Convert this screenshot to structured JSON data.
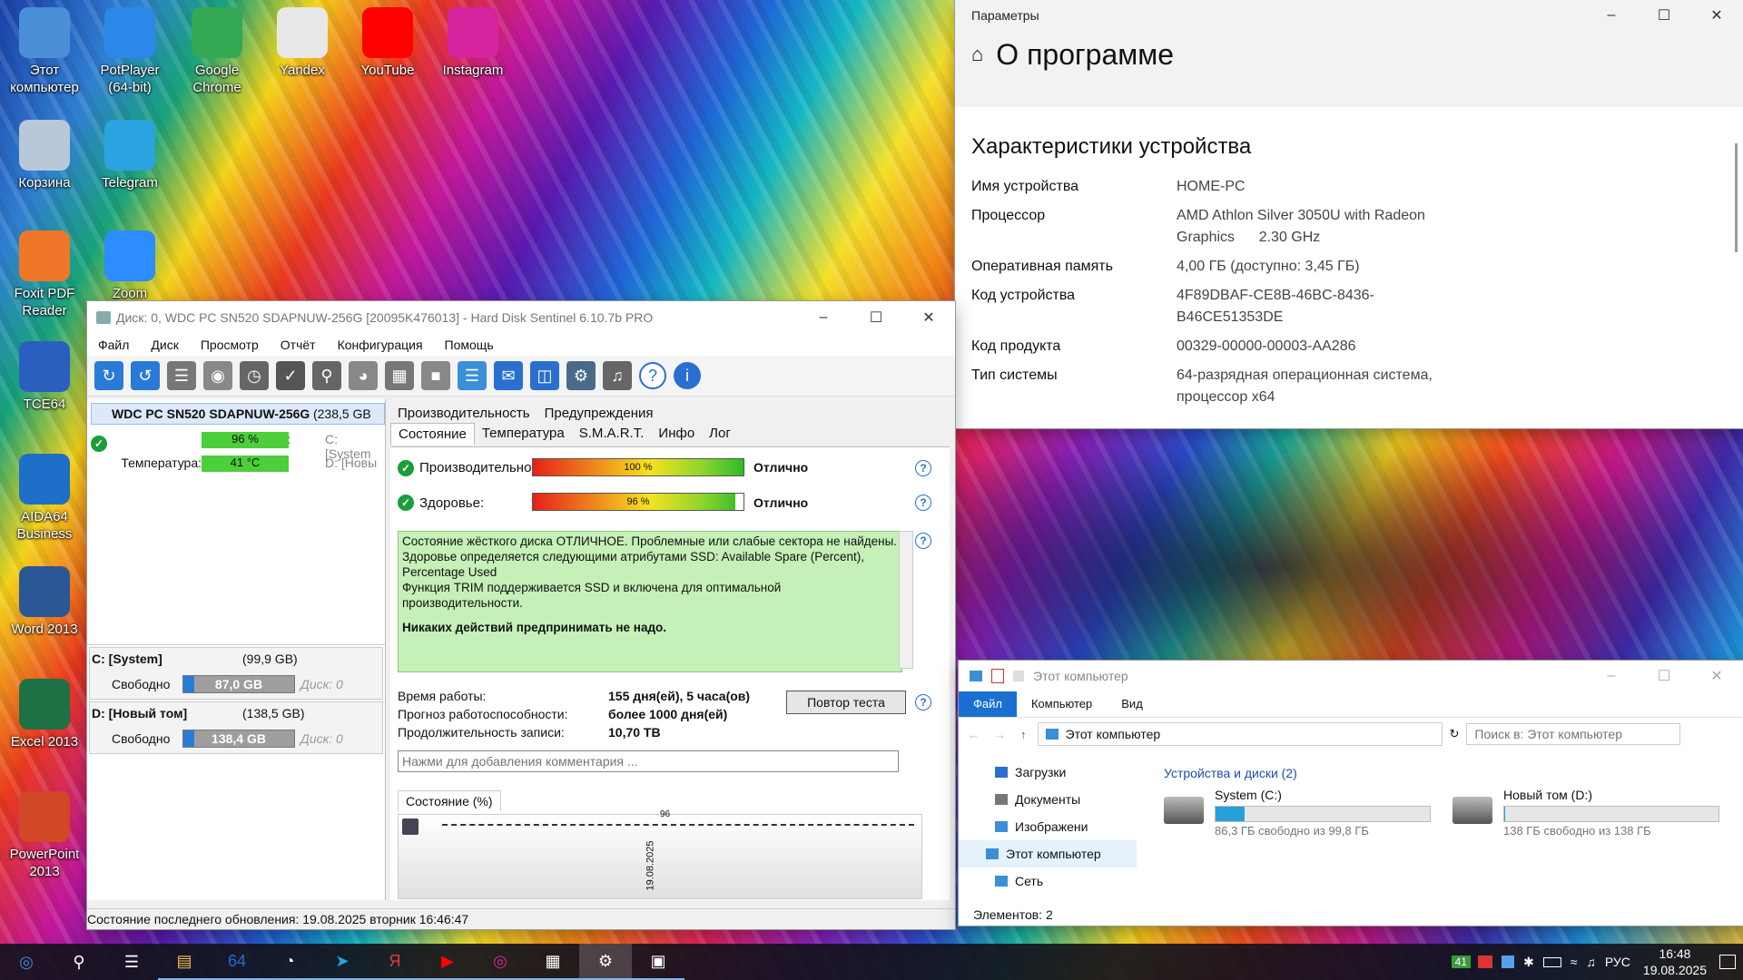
{
  "desktop": {
    "icons": [
      {
        "label": "Этот компьютер",
        "icon": "computer-icon",
        "color": "#4a8fd8"
      },
      {
        "label": "PotPlayer (64-bit)",
        "icon": "potplayer-icon",
        "color": "#2b88e8"
      },
      {
        "label": "Google Chrome",
        "icon": "chrome-icon",
        "color": "#34a853"
      },
      {
        "label": "Yandex",
        "icon": "yandex-icon",
        "color": "#e8e8e8"
      },
      {
        "label": "YouTube",
        "icon": "youtube-icon",
        "color": "#ff0000"
      },
      {
        "label": "Instagram",
        "icon": "instagram-icon",
        "color": "#d6249f"
      },
      {
        "label": "Корзина",
        "icon": "recycle-bin-icon",
        "color": "#b8c8d8"
      },
      {
        "label": "Telegram",
        "icon": "telegram-icon",
        "color": "#2aa3e0"
      },
      {
        "label": "Foxit PDF Reader",
        "icon": "foxit-icon",
        "color": "#f0772a"
      },
      {
        "label": "Zoom",
        "icon": "zoom-icon",
        "color": "#2d8cff"
      },
      {
        "label": "TCE64",
        "icon": "tce64-icon",
        "color": "#2a5fc0"
      },
      {
        "label": "AIDA64 Business",
        "icon": "aida64-icon",
        "color": "#1e6fc8"
      },
      {
        "label": "Word 2013",
        "icon": "word-icon",
        "color": "#2b5797"
      },
      {
        "label": "Excel 2013",
        "icon": "excel-icon",
        "color": "#1e7145"
      },
      {
        "label": "PowerPoint 2013",
        "icon": "powerpoint-icon",
        "color": "#d24726"
      }
    ]
  },
  "settings": {
    "title": "Параметры",
    "heading": "О программе",
    "section": "Характеристики устройства",
    "rows": [
      {
        "label": "Имя устройства",
        "value": "HOME-PC"
      },
      {
        "label": "Процессор",
        "value": "AMD Athlon Silver 3050U with Radeon Graphics      2.30 GHz"
      },
      {
        "label": "Оперативная память",
        "value": "4,00 ГБ (доступно: 3,45 ГБ)"
      },
      {
        "label": "Код устройства",
        "value": "4F89DBAF-CE8B-46BC-8436-B46CE51353DE"
      },
      {
        "label": "Код продукта",
        "value": "00329-00000-00003-AA286"
      },
      {
        "label": "Тип системы",
        "value": "64-разрядная операционная система, процессор x64"
      }
    ]
  },
  "hds": {
    "title": "Диск: 0, WDC PC SN520 SDAPNUW-256G [20095K476013]  -  Hard Disk Sentinel 6.10.7b PRO",
    "menu": [
      "Файл",
      "Диск",
      "Просмотр",
      "Отчёт",
      "Конфигурация",
      "Помощь"
    ],
    "disk_name": "WDC PC SN520 SDAPNUW-256G",
    "disk_size": "(238,5 GB",
    "health_label": "Здоровье:",
    "health_value": "96 %",
    "health_pct": 96,
    "health_side": "C: [System",
    "temp_label": "Температура:",
    "temp_value": "41 °C",
    "temp_side": "D: [Новы",
    "volumes": [
      {
        "name": "C: [System]",
        "size": "(99,9 GB)",
        "free_label": "Свободно",
        "free": "87,0 GB",
        "disk": "Диск: 0"
      },
      {
        "name": "D: [Новый том]",
        "size": "(138,5 GB)",
        "free_label": "Свободно",
        "free": "138,4 GB",
        "disk": "Диск: 0"
      }
    ],
    "tabs_top": [
      "Производительность",
      "Предупреждения"
    ],
    "tabs": [
      "Состояние",
      "Температура",
      "S.M.A.R.T.",
      "Инфо",
      "Лог"
    ],
    "perf_label": "Производительность:",
    "perf_value": "100 %",
    "perf_pct": 100,
    "perf_status": "Отлично",
    "hl_label": "Здоровье:",
    "hl_value": "96 %",
    "hl_status": "Отлично",
    "message_lines": [
      "Состояние жёсткого диска ОТЛИЧНОЕ. Проблемные или слабые сектора не найдены.",
      "Здоровье определяется следующими атрибутами SSD: Available Spare (Percent), Percentage Used",
      "Функция TRIM поддерживается SSD и включена для оптимальной производительности."
    ],
    "message_bold": "Никаких действий предпринимать не надо.",
    "uptime_label": "Время работы:",
    "uptime": "155 дня(ей), 5 часа(ов)",
    "forecast_label": "Прогноз работоспособности:",
    "forecast": "более 1000 дня(ей)",
    "writes_label": "Продолжительность записи:",
    "writes": "10,70 TB",
    "retest": "Повтор теста",
    "comment_placeholder": "Нажми для добавления комментария ...",
    "graph_tab": "Состояние (%)",
    "graph_date": "19.08.2025",
    "graph_top": "96",
    "status_bar": "Состояние последнего обновления: 19.08.2025 вторник 16:46:47"
  },
  "explorer": {
    "title": "Этот компьютер",
    "ribbon": [
      "Файл",
      "Компьютер",
      "Вид"
    ],
    "path": "Этот компьютер",
    "search_placeholder": "Поиск в: Этот компьютер",
    "nav": [
      {
        "label": "Загрузки"
      },
      {
        "label": "Документы"
      },
      {
        "label": "Изображени"
      },
      {
        "label": "Этот компьютер"
      },
      {
        "label": "Сеть"
      }
    ],
    "group": "Устройства и диски (2)",
    "drives": [
      {
        "name": "System (C:)",
        "free": "86,3 ГБ свободно из 99,8 ГБ",
        "used_pct": 13.5
      },
      {
        "name": "Новый том (D:)",
        "free": "138 ГБ свободно из 138 ГБ",
        "used_pct": 0.5
      }
    ],
    "status": "Элементов: 2"
  },
  "taskbar": {
    "apps": [
      "start-icon",
      "search-icon",
      "taskview-icon",
      "explorer-icon",
      "aida64-icon",
      "hdsentinel-icon",
      "telegram-icon",
      "yandex-icon",
      "youtube-icon",
      "instagram-icon",
      "notepad-icon",
      "settings-icon",
      "device-icon"
    ],
    "tray_badge": "41",
    "lang": "РУС",
    "time": "16:48",
    "date": "19.08.2025"
  }
}
